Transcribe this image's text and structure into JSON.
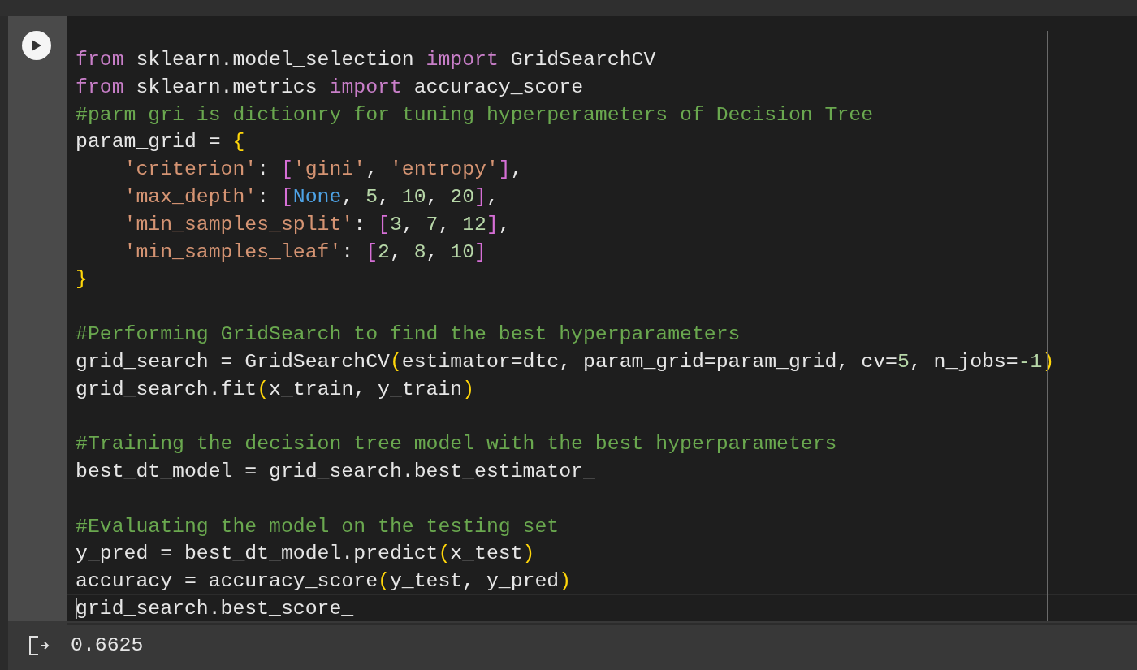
{
  "cell": {
    "blocks": [
      {
        "lines": [
          {
            "current": false,
            "tokens": [
              {
                "kind": "keyword",
                "text": "from"
              },
              {
                "kind": "plain",
                "text": " sklearn.model_selection "
              },
              {
                "kind": "keyword",
                "text": "import"
              },
              {
                "kind": "plain",
                "text": " GridSearchCV"
              }
            ]
          },
          {
            "current": false,
            "tokens": [
              {
                "kind": "keyword",
                "text": "from"
              },
              {
                "kind": "plain",
                "text": " sklearn.metrics "
              },
              {
                "kind": "keyword",
                "text": "import"
              },
              {
                "kind": "plain",
                "text": " accuracy_score"
              }
            ]
          },
          {
            "current": false,
            "tokens": [
              {
                "kind": "comment",
                "text": "#parm gri is dictionry for tuning hyperperameters of Decision Tree"
              }
            ]
          },
          {
            "current": false,
            "tokens": [
              {
                "kind": "plain",
                "text": "param_grid = "
              },
              {
                "kind": "paren",
                "text": "{"
              }
            ],
            "children": [
              {
                "current": false,
                "tokens": [
                  {
                    "kind": "string",
                    "text": "'criterion'"
                  },
                  {
                    "kind": "plain",
                    "text": ": "
                  },
                  {
                    "kind": "bracket",
                    "text": "["
                  },
                  {
                    "kind": "string",
                    "text": "'gini'"
                  },
                  {
                    "kind": "plain",
                    "text": ", "
                  },
                  {
                    "kind": "string",
                    "text": "'entropy'"
                  },
                  {
                    "kind": "bracket",
                    "text": "]"
                  },
                  {
                    "kind": "plain",
                    "text": ","
                  }
                ]
              },
              {
                "current": false,
                "tokens": [
                  {
                    "kind": "string",
                    "text": "'max_depth'"
                  },
                  {
                    "kind": "plain",
                    "text": ": "
                  },
                  {
                    "kind": "bracket",
                    "text": "["
                  },
                  {
                    "kind": "constant",
                    "text": "None"
                  },
                  {
                    "kind": "plain",
                    "text": ", "
                  },
                  {
                    "kind": "number",
                    "text": "5"
                  },
                  {
                    "kind": "plain",
                    "text": ", "
                  },
                  {
                    "kind": "number",
                    "text": "10"
                  },
                  {
                    "kind": "plain",
                    "text": ", "
                  },
                  {
                    "kind": "number",
                    "text": "20"
                  },
                  {
                    "kind": "bracket",
                    "text": "]"
                  },
                  {
                    "kind": "plain",
                    "text": ","
                  }
                ]
              },
              {
                "current": false,
                "tokens": [
                  {
                    "kind": "string",
                    "text": "'min_samples_split'"
                  },
                  {
                    "kind": "plain",
                    "text": ": "
                  },
                  {
                    "kind": "bracket",
                    "text": "["
                  },
                  {
                    "kind": "number",
                    "text": "3"
                  },
                  {
                    "kind": "plain",
                    "text": ", "
                  },
                  {
                    "kind": "number",
                    "text": "7"
                  },
                  {
                    "kind": "plain",
                    "text": ", "
                  },
                  {
                    "kind": "number",
                    "text": "12"
                  },
                  {
                    "kind": "bracket",
                    "text": "]"
                  },
                  {
                    "kind": "plain",
                    "text": ","
                  }
                ]
              },
              {
                "current": false,
                "tokens": [
                  {
                    "kind": "string",
                    "text": "'min_samples_leaf'"
                  },
                  {
                    "kind": "plain",
                    "text": ": "
                  },
                  {
                    "kind": "bracket",
                    "text": "["
                  },
                  {
                    "kind": "number",
                    "text": "2"
                  },
                  {
                    "kind": "plain",
                    "text": ", "
                  },
                  {
                    "kind": "number",
                    "text": "8"
                  },
                  {
                    "kind": "plain",
                    "text": ", "
                  },
                  {
                    "kind": "number",
                    "text": "10"
                  },
                  {
                    "kind": "bracket",
                    "text": "]"
                  }
                ]
              }
            ]
          },
          {
            "current": false,
            "tokens": [
              {
                "kind": "paren",
                "text": "}"
              }
            ]
          }
        ]
      },
      {
        "lines": [
          {
            "current": false,
            "tokens": [
              {
                "kind": "comment",
                "text": "#Performing GridSearch to find the best hyperparameters"
              }
            ]
          },
          {
            "current": false,
            "tokens": [
              {
                "kind": "plain",
                "text": "grid_search = GridSearchCV"
              },
              {
                "kind": "paren",
                "text": "("
              },
              {
                "kind": "plain",
                "text": "estimator=dtc, param_grid=param_grid, cv="
              },
              {
                "kind": "number",
                "text": "5"
              },
              {
                "kind": "plain",
                "text": ", n_jobs="
              },
              {
                "kind": "number",
                "text": "-1"
              },
              {
                "kind": "paren",
                "text": ")"
              }
            ]
          },
          {
            "current": false,
            "tokens": [
              {
                "kind": "plain",
                "text": "grid_search.fit"
              },
              {
                "kind": "paren",
                "text": "("
              },
              {
                "kind": "plain",
                "text": "x_train, y_train"
              },
              {
                "kind": "paren",
                "text": ")"
              }
            ]
          }
        ]
      },
      {
        "lines": [
          {
            "current": false,
            "tokens": [
              {
                "kind": "comment",
                "text": "#Training the decision tree model with the best hyperparameters"
              }
            ]
          },
          {
            "current": false,
            "tokens": [
              {
                "kind": "plain",
                "text": "best_dt_model = grid_search.best_estimator_"
              }
            ]
          }
        ]
      },
      {
        "lines": [
          {
            "current": false,
            "tokens": [
              {
                "kind": "comment",
                "text": "#Evaluating the model on the testing set"
              }
            ]
          },
          {
            "current": false,
            "tokens": [
              {
                "kind": "plain",
                "text": "y_pred = best_dt_model.predict"
              },
              {
                "kind": "paren",
                "text": "("
              },
              {
                "kind": "plain",
                "text": "x_test"
              },
              {
                "kind": "paren",
                "text": ")"
              }
            ]
          },
          {
            "current": false,
            "tokens": [
              {
                "kind": "plain",
                "text": "accuracy = accuracy_score"
              },
              {
                "kind": "paren",
                "text": "("
              },
              {
                "kind": "plain",
                "text": "y_test, y_pred"
              },
              {
                "kind": "paren",
                "text": ")"
              }
            ]
          },
          {
            "current": true,
            "tokens": [
              {
                "kind": "plain",
                "text": "grid_search.best_score_"
              }
            ]
          }
        ]
      }
    ],
    "output": "0.6625"
  }
}
